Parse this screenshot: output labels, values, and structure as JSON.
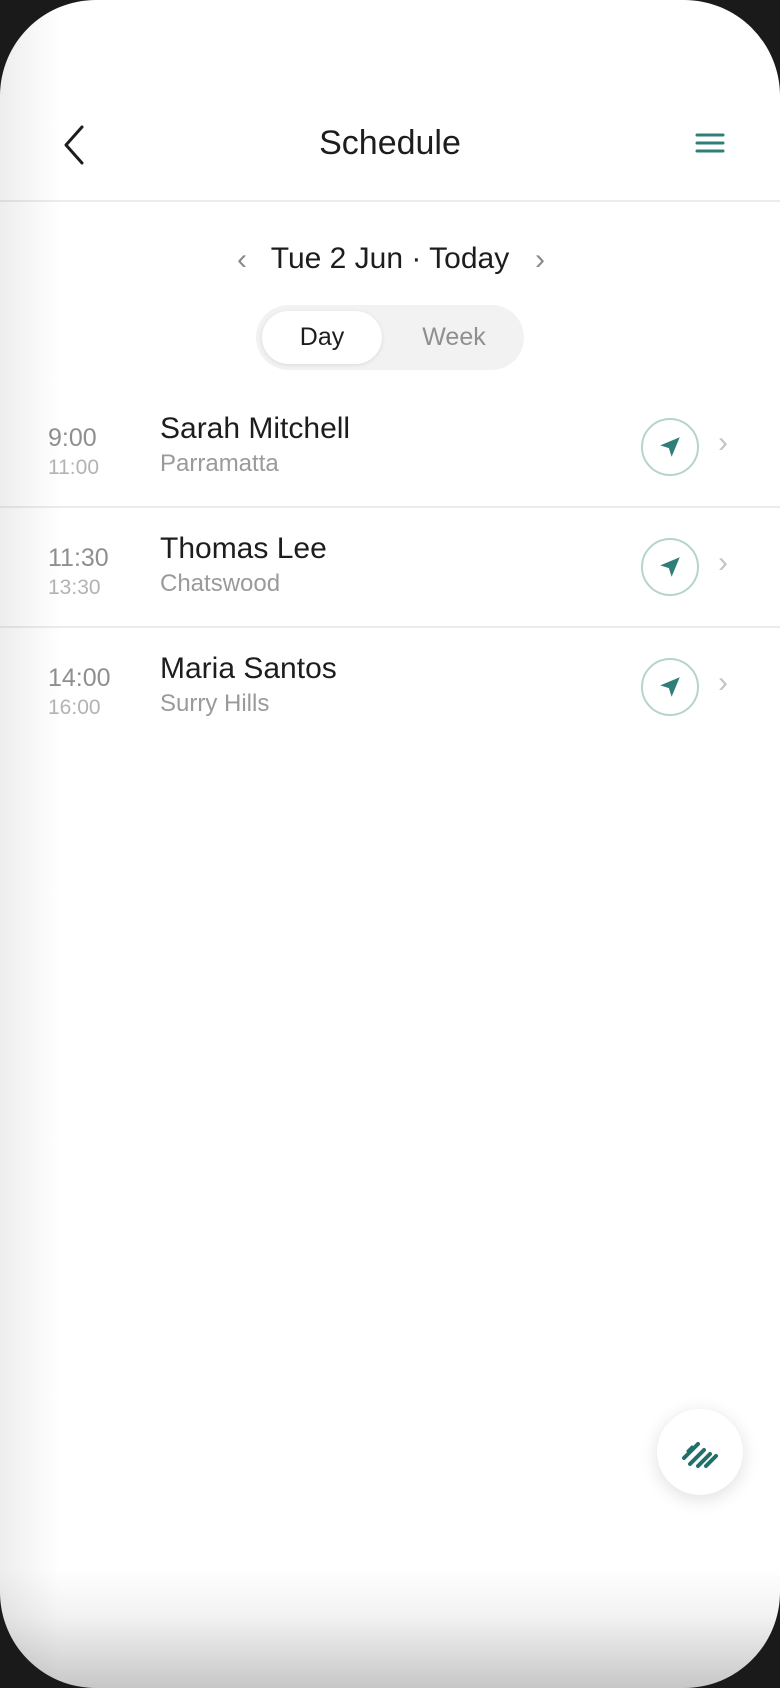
{
  "header": {
    "title": "Schedule",
    "back_icon": "chevron-left-icon",
    "menu_icon": "hamburger-menu-icon"
  },
  "date_nav": {
    "prev": "‹",
    "label": "Tue 2 Jun · Today",
    "next": "›"
  },
  "view_toggle": {
    "options": [
      "Day",
      "Week"
    ],
    "selected": "Day"
  },
  "appointments": [
    {
      "start": "9:00",
      "end": "11:00",
      "name": "Sarah Mitchell",
      "location": "Parramatta"
    },
    {
      "start": "11:30",
      "end": "13:30",
      "name": "Thomas Lee",
      "location": "Chatswood"
    },
    {
      "start": "14:00",
      "end": "16:00",
      "name": "Maria Santos",
      "location": "Surry Hills"
    }
  ],
  "row_chevron": "›",
  "colors": {
    "accent": "#2f7f78",
    "text": "#1d1d1d",
    "muted": "#8f8f8f",
    "divider": "#ececec"
  },
  "icons": {
    "navigate": "navigation-arrow-icon",
    "fab": "quick-log-icon"
  }
}
